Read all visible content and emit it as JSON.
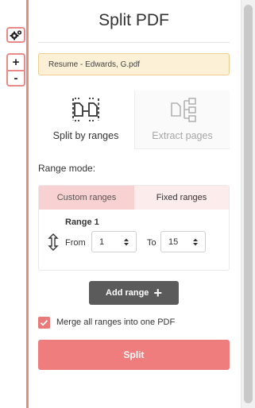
{
  "title": "Split PDF",
  "file_name": "Resume - Edwards, G.pdf",
  "rail": {
    "settings_icon": "gears-icon",
    "zoom_in_label": "+",
    "zoom_out_label": "-"
  },
  "modes": [
    {
      "label": "Split by ranges",
      "icon": "split-ranges-icon",
      "active": true
    },
    {
      "label": "Extract pages",
      "icon": "extract-pages-icon",
      "active": false
    }
  ],
  "range_mode_label": "Range mode:",
  "range_tabs": [
    {
      "label": "Custom ranges",
      "active": true
    },
    {
      "label": "Fixed ranges",
      "active": false
    }
  ],
  "range": {
    "title": "Range 1",
    "from_label": "From",
    "from_value": "1",
    "to_label": "To",
    "to_value": "15"
  },
  "add_range_label": "Add range",
  "add_range_icon": "+",
  "merge": {
    "label": "Merge all ranges into one PDF",
    "checked": true
  },
  "split_label": "Split",
  "colors": {
    "accent": "#ef7d7d",
    "rail": "#e88a8a",
    "file_bg": "#fcf0d6",
    "tab_active": "#f8d2d2",
    "tab_inactive": "#fdecec",
    "add_button": "#5b5b5b"
  }
}
